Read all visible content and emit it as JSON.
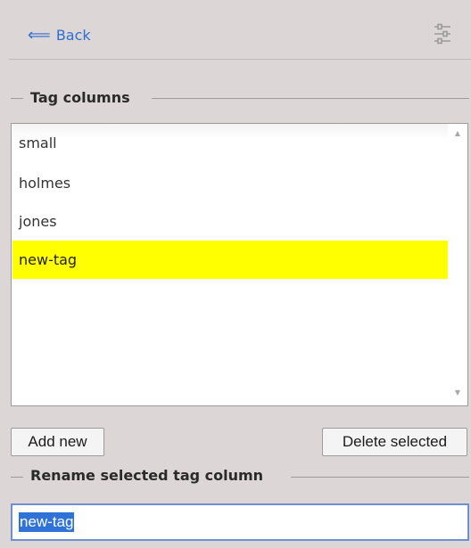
{
  "header": {
    "back_label": "Back",
    "back_icon": "arrow-left-icon",
    "settings_icon": "sliders-icon"
  },
  "tag_columns": {
    "legend": "Tag columns",
    "items": [
      "small",
      "holmes",
      "jones",
      "new-tag"
    ],
    "selected_index": 3,
    "selected_color": "#ffff00"
  },
  "buttons": {
    "add_new": "Add new",
    "delete_selected": "Delete selected"
  },
  "rename": {
    "legend": "Rename selected tag column",
    "value": "new-tag",
    "highlight_color": "#2f73d8"
  }
}
